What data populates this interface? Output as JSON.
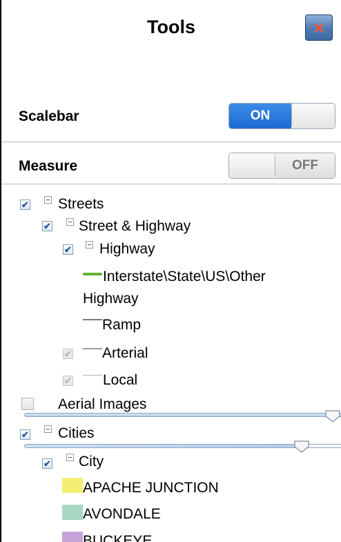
{
  "header": {
    "title": "Tools",
    "close_icon": "×"
  },
  "scalebar": {
    "label": "Scalebar",
    "state": "ON"
  },
  "measure": {
    "label": "Measure",
    "state": "OFF"
  },
  "layers": {
    "streets": "Streets",
    "street_highway": "Street & Highway",
    "highway": "Highway",
    "interstate": "Interstate\\State\\US\\Other Highway",
    "interstate_line1": "Interstate\\State\\US\\Other",
    "interstate_line2": "Highway",
    "ramp": "Ramp",
    "arterial": "Arterial",
    "local": "Local",
    "aerial": "Aerial Images",
    "cities": "Cities",
    "city": "City",
    "city_items": [
      "APACHE JUNCTION",
      "AVONDALE",
      "BUCKEYE"
    ]
  },
  "colors": {
    "interstate": "#62b22c",
    "ramp": "#7a7a7a",
    "arterial": "#9a9a9a",
    "local": "#b5b5b5",
    "apache_junction": "#f4ef73",
    "avondale": "#a7d8c1",
    "buckeye": "#c4a3d6"
  },
  "sliders": {
    "aerial_opacity": 0.95,
    "cities_opacity": 0.86
  }
}
